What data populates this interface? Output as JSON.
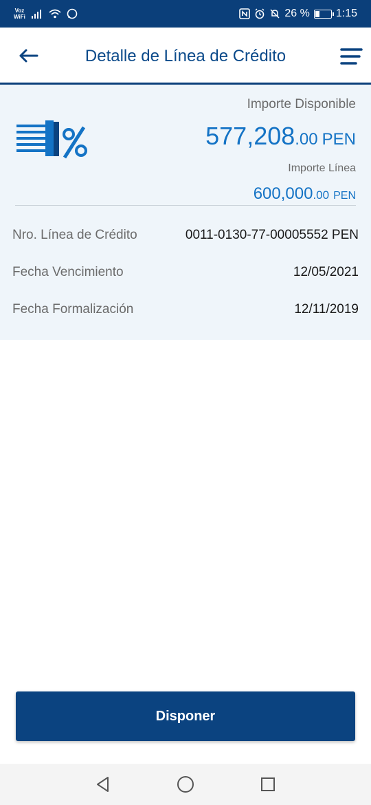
{
  "status_bar": {
    "carrier_top": "Voz",
    "carrier_bottom": "WiFi",
    "battery": "26 %",
    "time": "1:15"
  },
  "header": {
    "title": "Detalle de Línea de Crédito"
  },
  "summary": {
    "available_label": "Importe Disponible",
    "available_int": "577,208",
    "available_dec": ".00",
    "available_currency": "PEN",
    "line_label": "Importe Línea",
    "line_int": "600,000",
    "line_dec": ".00",
    "line_currency": "PEN"
  },
  "details": [
    {
      "label": "Nro. Línea de Crédito",
      "value": "0011-0130-77-00005552 PEN"
    },
    {
      "label": "Fecha Vencimiento",
      "value": "12/05/2021"
    },
    {
      "label": "Fecha Formalización",
      "value": "12/11/2019"
    }
  ],
  "actions": {
    "primary_label": "Disponer"
  },
  "colors": {
    "brand": "#0b3f7a",
    "accent": "#1473c5",
    "panel": "#eff5fa"
  }
}
